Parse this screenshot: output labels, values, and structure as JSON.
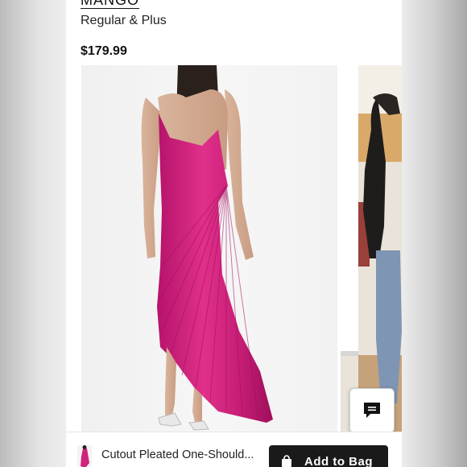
{
  "product": {
    "brand": "MANGO",
    "fit": "Regular & Plus",
    "price": "$179.99",
    "name": "Cutout Pleated One-Should..."
  },
  "actions": {
    "add_to_bag_label": "Add to Bag"
  },
  "colors": {
    "dress": "#d0237b",
    "button_bg": "#1a1a1a",
    "background": "#ffffff"
  },
  "icons": {
    "chat": "chat-bubble-icon",
    "bag": "shopping-bag-icon"
  }
}
